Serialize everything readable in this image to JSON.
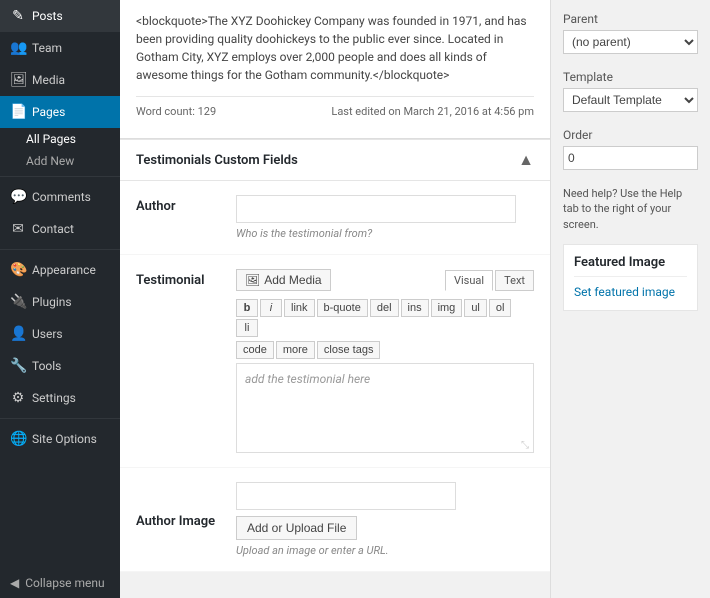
{
  "sidebar": {
    "items": [
      {
        "id": "posts",
        "label": "Posts",
        "icon": "✎"
      },
      {
        "id": "team",
        "label": "Team",
        "icon": "👥"
      },
      {
        "id": "media",
        "label": "Media",
        "icon": "🖼"
      },
      {
        "id": "pages",
        "label": "Pages",
        "icon": "📄",
        "active": true
      },
      {
        "id": "comments",
        "label": "Comments",
        "icon": "💬"
      },
      {
        "id": "contact",
        "label": "Contact",
        "icon": "✉"
      },
      {
        "id": "appearance",
        "label": "Appearance",
        "icon": "🎨"
      },
      {
        "id": "plugins",
        "label": "Plugins",
        "icon": "🔌"
      },
      {
        "id": "users",
        "label": "Users",
        "icon": "👤"
      },
      {
        "id": "tools",
        "label": "Tools",
        "icon": "🔧"
      },
      {
        "id": "settings",
        "label": "Settings",
        "icon": "⚙"
      },
      {
        "id": "site-options",
        "label": "Site Options",
        "icon": "🌐"
      }
    ],
    "sub_items": [
      {
        "id": "all-pages",
        "label": "All Pages",
        "active": true
      },
      {
        "id": "add-new",
        "label": "Add New"
      }
    ],
    "collapse_label": "Collapse menu"
  },
  "content": {
    "blockquote": "<blockquote>The XYZ Doohickey Company was founded in 1971, and has been providing quality doohickeys to the public ever since. Located in Gotham City, XYZ employs over 2,000 people and does all kinds of awesome things for the Gotham community.</blockquote>",
    "word_count_label": "Word count: 129",
    "last_edited": "Last edited on March 21, 2016 at 4:56 pm"
  },
  "custom_fields": {
    "title": "Testimonials Custom Fields",
    "author_label": "Author",
    "author_placeholder": "",
    "author_hint": "Who is the testimonial from?",
    "testimonial_label": "Testimonial",
    "add_media_label": "Add Media",
    "media_icon": "🖼",
    "visual_tab": "Visual",
    "text_tab": "Text",
    "format_buttons": [
      "b",
      "i",
      "link",
      "b-quote",
      "del",
      "ins",
      "img",
      "ul",
      "ol",
      "li",
      "code",
      "more",
      "close tags"
    ],
    "editor_placeholder": "add the testimonial here",
    "author_image_label": "Author Image",
    "author_image_input": "",
    "upload_button_label": "Add or Upload File",
    "upload_hint": "Upload an image or enter a URL."
  },
  "right_sidebar": {
    "parent_label": "Parent",
    "parent_value": "(no parent)",
    "template_label": "Template",
    "template_value": "Default Template",
    "order_label": "Order",
    "order_value": "0",
    "help_text": "Need help? Use the Help tab to the right of your screen.",
    "featured_image_title": "Featured Image",
    "set_featured_label": "Set featured image"
  }
}
